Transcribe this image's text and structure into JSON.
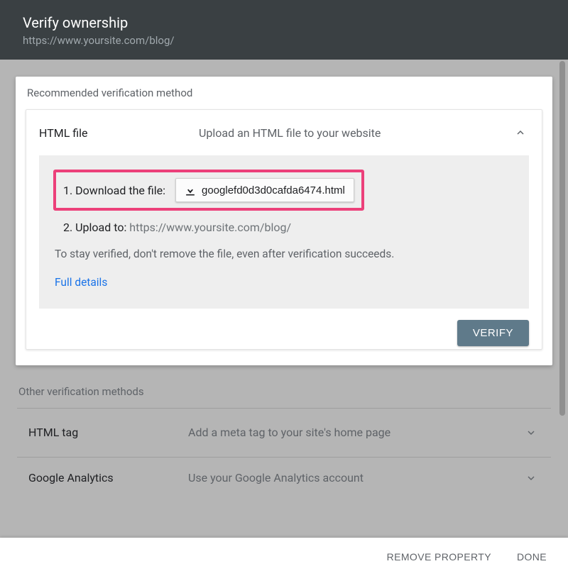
{
  "header": {
    "title": "Verify ownership",
    "url": "https://www.yoursite.com/blog/"
  },
  "recommended": {
    "sectionLabel": "Recommended verification method",
    "method": {
      "name": "HTML file",
      "description": "Upload an HTML file to your website",
      "step1Label": "1. Download the file:",
      "downloadFilename": "googlefd0d3d0cafda6474.html",
      "step2Prefix": "2. Upload to: ",
      "step2Url": "https://www.yoursite.com/blog/",
      "note": "To stay verified, don't remove the file, even after verification succeeds.",
      "detailsLink": "Full details",
      "verifyLabel": "VERIFY"
    }
  },
  "other": {
    "sectionLabel": "Other verification methods",
    "items": [
      {
        "name": "HTML tag",
        "description": "Add a meta tag to your site's home page"
      },
      {
        "name": "Google Analytics",
        "description": "Use your Google Analytics account"
      }
    ]
  },
  "footer": {
    "removeProperty": "REMOVE PROPERTY",
    "done": "DONE"
  }
}
